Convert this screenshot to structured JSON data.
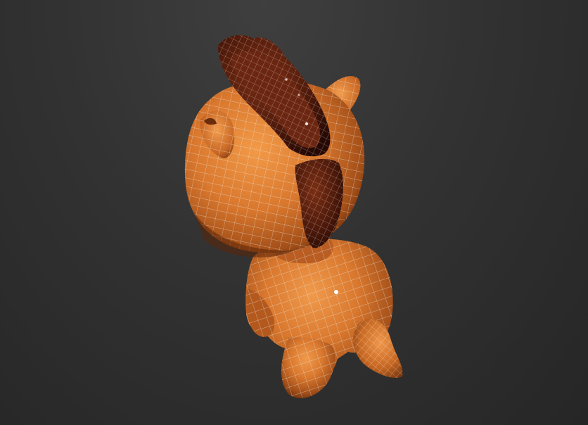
{
  "viewport": {
    "background_top": "#404040",
    "background_bottom": "#262626"
  },
  "model": {
    "subject": "cartoon-pony-model",
    "render_mode": "smooth-shaded-with-wireframe",
    "colors": {
      "body": "#d9782e",
      "body_dark": "#8a3f10",
      "mane": "#5a1f0e",
      "mane_dark": "#2e0c05",
      "wire": "#e8e0d6",
      "highlight": "#ffffff"
    }
  }
}
